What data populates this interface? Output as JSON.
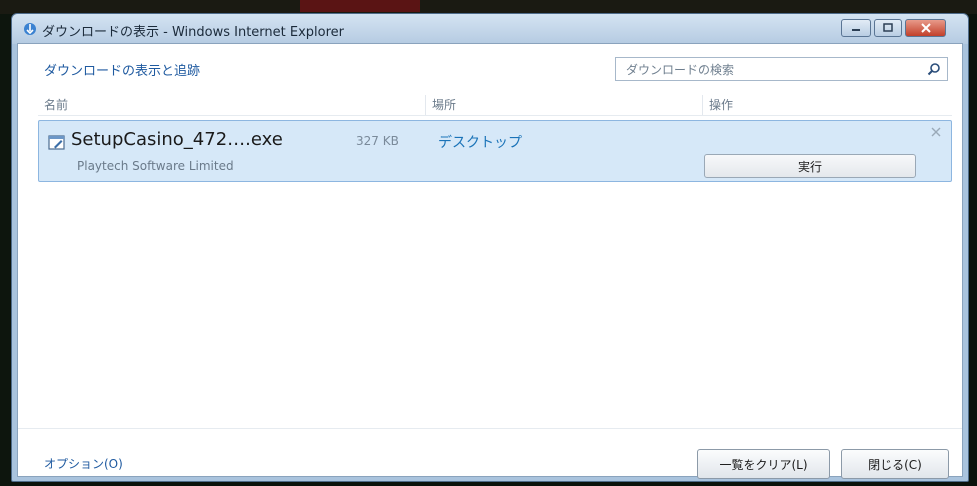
{
  "window": {
    "title": "ダウンロードの表示 - Windows Internet Explorer",
    "heading": "ダウンロードの表示と追跡"
  },
  "search": {
    "placeholder": "ダウンロードの検索"
  },
  "columns": {
    "name": "名前",
    "location": "場所",
    "action": "操作"
  },
  "downloads": [
    {
      "filename": "SetupCasino_472….exe",
      "size": "327 KB",
      "location": "デスクトップ",
      "publisher": "Playtech Software Limited",
      "action_label": "実行"
    }
  ],
  "footer": {
    "options_label": "オプション(O)",
    "clear_label": "一覧をクリア(L)",
    "close_label": "閉じる(C)"
  },
  "colors": {
    "accent": "#1f5aa0",
    "row_highlight": "#d6e8f8",
    "close_red": "#c2402a"
  }
}
